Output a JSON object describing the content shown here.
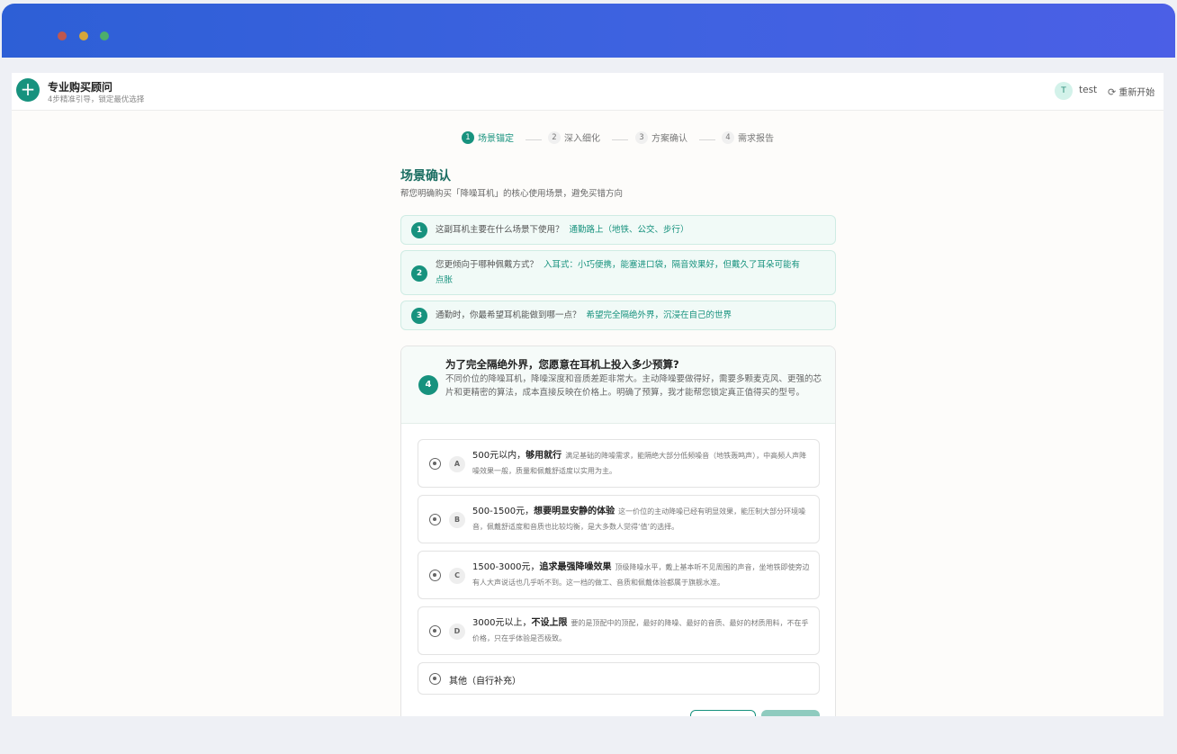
{
  "app": {
    "logo_symbol": "+",
    "title": "专业购买顾问",
    "subtitle": "4步精准引导，锁定最优选择",
    "user_initial": "T",
    "username": "test",
    "restart_icon": "refresh-icon",
    "restart_label": "重新开始"
  },
  "steps": [
    {
      "num": "1",
      "label": "场景锚定",
      "active": true
    },
    {
      "num": "2",
      "label": "深入细化",
      "active": false
    },
    {
      "num": "3",
      "label": "方案确认",
      "active": false
    },
    {
      "num": "4",
      "label": "需求报告",
      "active": false
    }
  ],
  "section": {
    "title": "场景确认",
    "subtitle": "帮您明确购买「降噪耳机」的核心使用场景，避免买错方向"
  },
  "answered": [
    {
      "num": "1",
      "question": "这副耳机主要在什么场景下使用？",
      "answer": "通勤路上（地铁、公交、步行）"
    },
    {
      "num": "2",
      "question": "您更倾向于哪种佩戴方式？",
      "answer": "入耳式：小巧便携，能塞进口袋，隔音效果好，但戴久了耳朵可能有点胀"
    },
    {
      "num": "3",
      "question": "通勤时，你最希望耳机能做到哪一点？",
      "answer": "希望完全隔绝外界，沉浸在自己的世界"
    }
  ],
  "current": {
    "num": "4",
    "question": "为了完全隔绝外界，您愿意在耳机上投入多少预算?",
    "description": "不同价位的降噪耳机，降噪深度和音质差距非常大。主动降噪要做得好，需要多颗麦克风、更强的芯片和更精密的算法，成本直接反映在价格上。明确了预算，我才能帮您锁定真正值得买的型号。",
    "options": [
      {
        "letter": "A",
        "title_plain": "500元以内，",
        "title_bold": "够用就行",
        "desc": "满足基础的降噪需求，能隔绝大部分低频噪音（地铁轰鸣声），中高频人声降噪效果一般，质量和佩戴舒适度以实用为主。"
      },
      {
        "letter": "B",
        "title_plain": "500-1500元，",
        "title_bold": "想要明显安静的体验",
        "desc": "这一价位的主动降噪已经有明显效果，能压制大部分环境噪音，佩戴舒适度和音质也比较均衡，是大多数人觉得‘值’的选择。"
      },
      {
        "letter": "C",
        "title_plain": "1500-3000元，",
        "title_bold": "追求最强降噪效果",
        "desc": "顶级降噪水平，戴上基本听不见周围的声音，坐地铁即使旁边有人大声说话也几乎听不到。这一档的做工、音质和佩戴体验都属于旗舰水准。"
      },
      {
        "letter": "D",
        "title_plain": "3000元以上，",
        "title_bold": "不设上限",
        "desc": "要的是顶配中的顶配，最好的降噪、最好的音质、最好的材质用料，不在乎价格，只在乎体验是否极致。"
      }
    ],
    "other_label": "其他（自行补充）"
  }
}
